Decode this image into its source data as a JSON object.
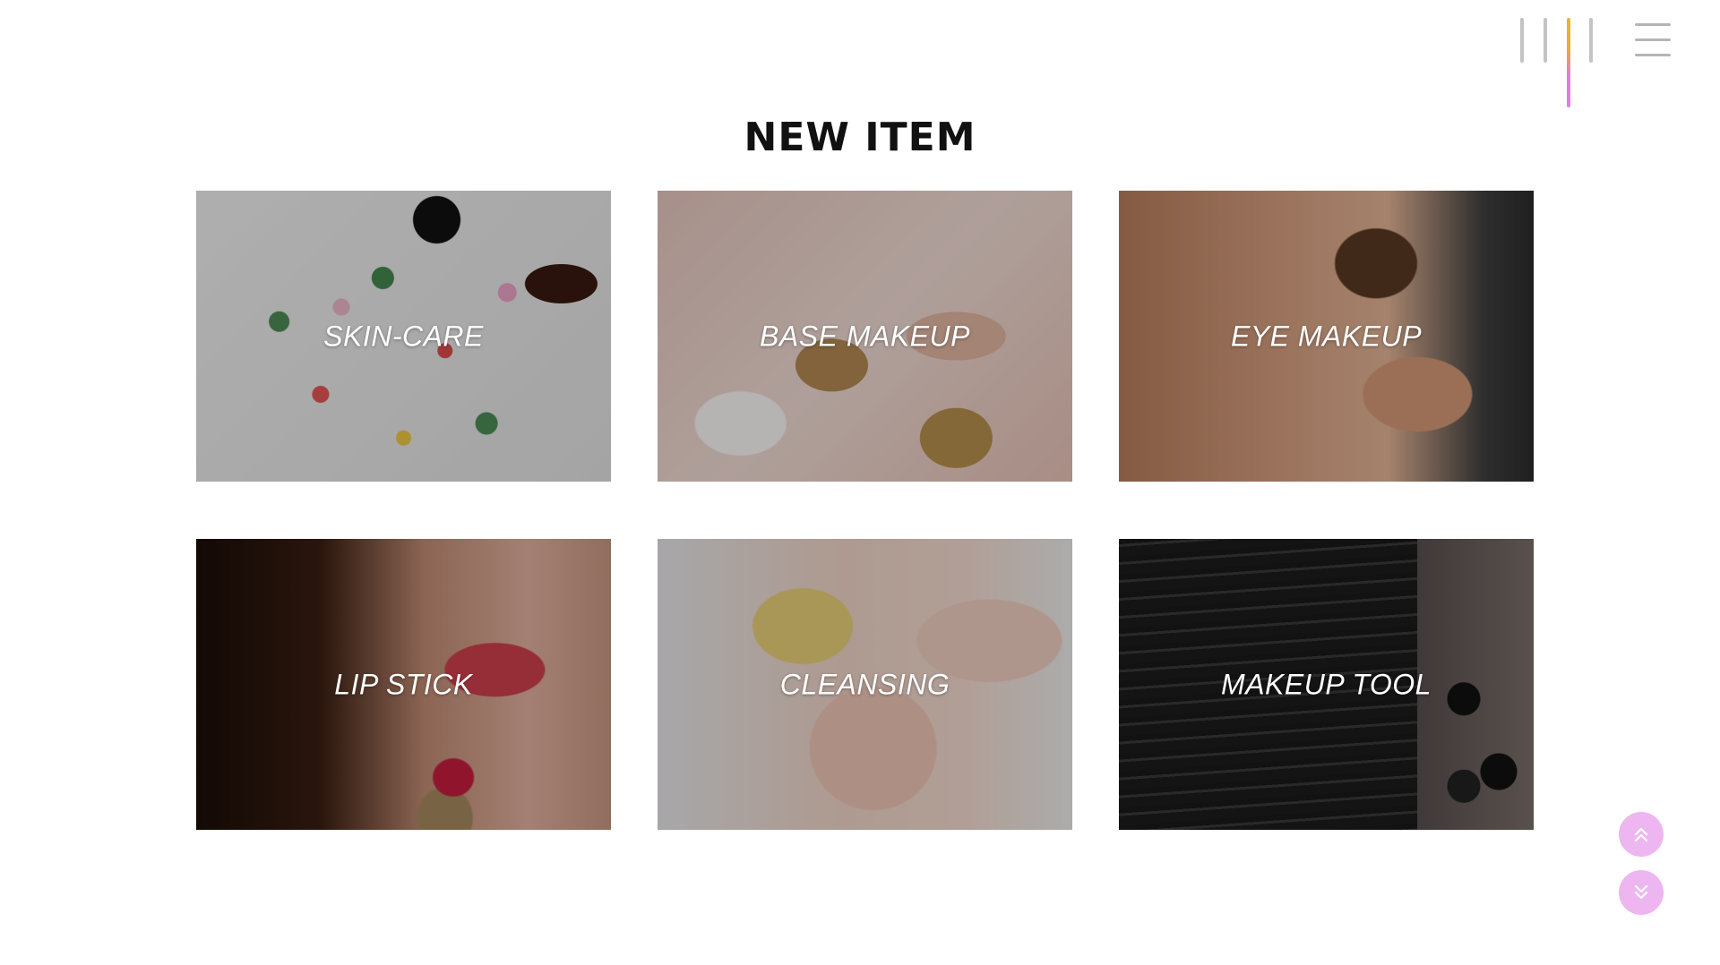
{
  "header": {
    "menu_icon": "hamburger-menu-icon",
    "indicator_accent_colors": [
      "#f0b428",
      "#e47be6"
    ]
  },
  "section": {
    "title": "NEW ITEM"
  },
  "categories": [
    {
      "label": "SKIN-CARE"
    },
    {
      "label": "BASE MAKEUP"
    },
    {
      "label": "EYE MAKEUP"
    },
    {
      "label": "LIP STICK"
    },
    {
      "label": "CLEANSING"
    },
    {
      "label": "MAKEUP TOOL"
    }
  ],
  "scroll_controls": {
    "up_icon": "double-chevron-up-icon",
    "down_icon": "double-chevron-down-icon",
    "color": "#edb6f0"
  }
}
